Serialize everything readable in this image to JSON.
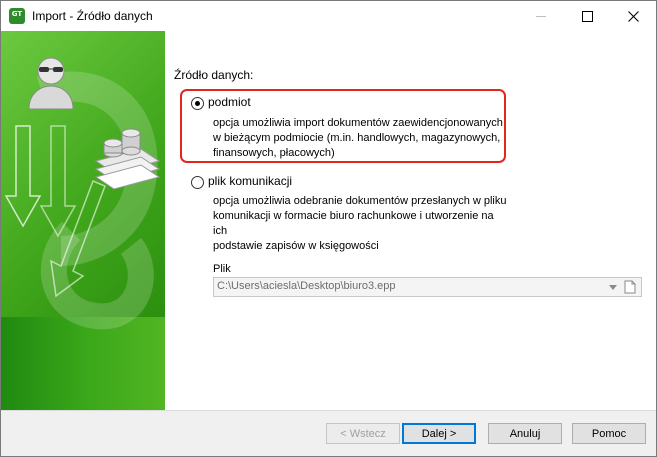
{
  "window": {
    "title": "Import - Źródło danych",
    "icon": "gt-app-icon"
  },
  "main": {
    "source_label": "Źródło danych:",
    "options": [
      {
        "label": "podmiot",
        "selected": true,
        "description": "opcja umożliwia import dokumentów zaewidencjonowanych\nw bieżącym podmiocie (m.in. handlowych, magazynowych,\nfinansowych, płacowych)"
      },
      {
        "label": "plik komunikacji",
        "selected": false,
        "description": "opcja umożliwia odebranie dokumentów przesłanych w pliku\nkomunikacji w formacie biuro rachunkowe i utworzenie na ich\npodstawie zapisów w księgowości"
      }
    ],
    "file": {
      "label": "Plik",
      "value": "C:\\Users\\aciesla\\Desktop\\biuro3.epp"
    }
  },
  "footer": {
    "back_label": "< Wstecz",
    "next_label": "Dalej >",
    "cancel_label": "Anuluj",
    "help_label": "Pomoc"
  },
  "colors": {
    "banner_green": "#3ca81a",
    "highlight_red": "#e2261d",
    "default_button_border": "#0078d7"
  }
}
